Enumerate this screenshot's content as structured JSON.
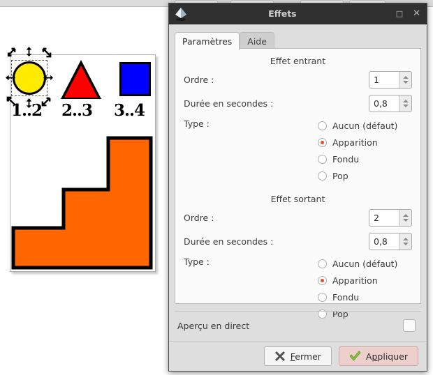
{
  "window": {
    "title": "Effets",
    "icon": "inkscape-logo-icon",
    "buttons": {
      "maximize": "□",
      "close": "✕"
    }
  },
  "tabs": [
    {
      "label": "Paramètres",
      "active": true
    },
    {
      "label": "Aide",
      "active": false
    }
  ],
  "sections": [
    {
      "title": "Effet entrant",
      "order_label": "Ordre :",
      "order_value": "1",
      "duration_label": "Durée en secondes :",
      "duration_value": "0,8",
      "type_label": "Type :",
      "options": [
        {
          "label": "Aucun (défaut)",
          "selected": false
        },
        {
          "label": "Apparition",
          "selected": true
        },
        {
          "label": "Fondu",
          "selected": false
        },
        {
          "label": "Pop",
          "selected": false
        }
      ]
    },
    {
      "title": "Effet sortant",
      "order_label": "Ordre :",
      "order_value": "2",
      "duration_label": "Durée en secondes :",
      "duration_value": "0,8",
      "type_label": "Type :",
      "options": [
        {
          "label": "Aucun (défaut)",
          "selected": false
        },
        {
          "label": "Apparition",
          "selected": true
        },
        {
          "label": "Fondu",
          "selected": false
        },
        {
          "label": "Pop",
          "selected": false
        }
      ]
    }
  ],
  "preview": {
    "label": "Aperçu en direct",
    "checked": false
  },
  "actions": {
    "close": {
      "label": "Fermer",
      "mnemonic": "F",
      "rest": "ermer",
      "icon": "close-x-icon"
    },
    "apply": {
      "label": "Appliquer",
      "mnemonic_prefix": "A",
      "mnemonic": "p",
      "rest": "pliquer",
      "icon": "check-mark-icon"
    }
  },
  "canvas": {
    "labels": [
      "1..2",
      "2..3",
      "3..4"
    ],
    "shapes": [
      {
        "name": "circle",
        "color": "#ffeb00",
        "selected": true
      },
      {
        "name": "triangle",
        "color": "#ff0000",
        "selected": false
      },
      {
        "name": "square",
        "color": "#0000ff",
        "selected": false
      },
      {
        "name": "stairs",
        "color": "#ff6600",
        "selected": false
      }
    ]
  },
  "colors": {
    "titlebar": "#303030",
    "dialog_bg": "#dedede",
    "panel_bg": "#fbfbfb",
    "radio_selected": "#e0502a",
    "apply_bg": "#edcfcc",
    "stairs": "#ff6600"
  }
}
